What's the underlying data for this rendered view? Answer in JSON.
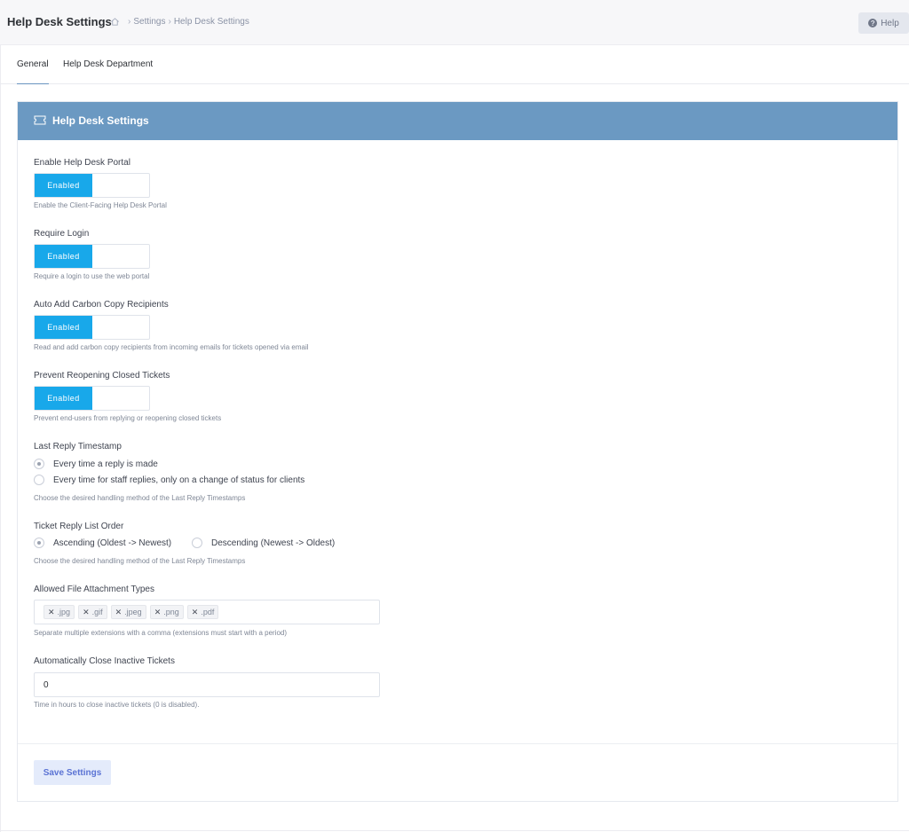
{
  "header": {
    "title": "Help Desk Settings",
    "breadcrumb": [
      "Settings",
      "Help Desk Settings"
    ],
    "help_label": "Help"
  },
  "tabs": [
    {
      "label": "General",
      "active": true
    },
    {
      "label": "Help Desk Department",
      "active": false
    }
  ],
  "card": {
    "title": "Help Desk Settings",
    "header_color": "#6b99c2"
  },
  "settings": {
    "portal": {
      "label": "Enable Help Desk Portal",
      "state": "Enabled",
      "help": "Enable the Client-Facing Help Desk Portal"
    },
    "login": {
      "label": "Require Login",
      "state": "Enabled",
      "help": "Require a login to use the web portal"
    },
    "cc": {
      "label": "Auto Add Carbon Copy Recipients",
      "state": "Enabled",
      "help": "Read and add carbon copy recipients from incoming emails for tickets opened via email"
    },
    "reopen": {
      "label": "Prevent Reopening Closed Tickets",
      "state": "Enabled",
      "help": "Prevent end-users from replying or reopening closed tickets"
    },
    "timestamp": {
      "label": "Last Reply Timestamp",
      "options": [
        "Every time a reply is made",
        "Every time for staff replies, only on a change of status for clients"
      ],
      "selected": 0,
      "help": "Choose the desired handling method of the Last Reply Timestamps"
    },
    "order": {
      "label": "Ticket Reply List Order",
      "options": [
        "Ascending (Oldest -> Newest)",
        "Descending (Newest -> Oldest)"
      ],
      "selected": 0,
      "help": "Choose the desired handling method of the Last Reply Timestamps"
    },
    "attachments": {
      "label": "Allowed File Attachment Types",
      "tags": [
        ".jpg",
        ".gif",
        ".jpeg",
        ".png",
        ".pdf"
      ],
      "help": "Separate multiple extensions with a comma (extensions must start with a period)"
    },
    "autoclose": {
      "label": "Automatically Close Inactive Tickets",
      "value": "0",
      "help": "Time in hours to close inactive tickets (0 is disabled)."
    }
  },
  "save_label": "Save Settings",
  "colors": {
    "toggle_on": "#18a8ea",
    "save_button_bg": "#e4ebfb",
    "save_button_text": "#5b73d4"
  }
}
